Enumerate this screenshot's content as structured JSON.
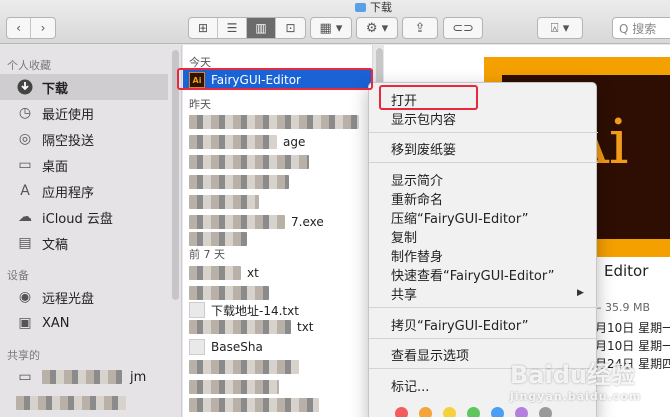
{
  "window": {
    "title": "下载"
  },
  "toolbar": {
    "back_icon": "chevron-left",
    "forward_icon": "chevron-right",
    "view_icons": [
      "⊞",
      "☰",
      "▥",
      "⊡"
    ],
    "group_icon": "▦ ▾",
    "action_icon": "⚙ ▾",
    "share_icon": "⇪",
    "tag_icon": "⊂⊃",
    "dropbox_icon": "⍓ ▾",
    "search_placeholder": "Q 搜索"
  },
  "sidebar": {
    "favorites_header": "个人收藏",
    "favorites": [
      {
        "label": "下载",
        "icon": "download-icon"
      },
      {
        "label": "最近使用",
        "icon": "clock-icon"
      },
      {
        "label": "隔空投送",
        "icon": "airdrop-icon"
      },
      {
        "label": "桌面",
        "icon": "desktop-icon"
      },
      {
        "label": "应用程序",
        "icon": "applications-icon"
      },
      {
        "label": "iCloud 云盘",
        "icon": "cloud-icon"
      },
      {
        "label": "文稿",
        "icon": "document-icon"
      }
    ],
    "devices_header": "设备",
    "devices": [
      {
        "label": "远程光盘",
        "icon": "disc-icon"
      },
      {
        "label": "XAN",
        "icon": "drive-icon"
      }
    ],
    "shared_header": "共享的",
    "shared_tail": "jm"
  },
  "files": {
    "today_header": "今天",
    "selected_file": "FairyGUI-Editor",
    "yesterday_header": "昨天",
    "yesterday_snippets": [
      "age",
      "7.exe"
    ],
    "week_header": "前 7 天",
    "week_snippets": [
      "xt",
      "下载地址-14.txt",
      "txt",
      "BaseSha"
    ]
  },
  "context_menu": {
    "open": "打开",
    "show_package": "显示包内容",
    "move_trash": "移到废纸篓",
    "get_info": "显示简介",
    "rename": "重新命名",
    "compress": "压缩“FairyGUI-Editor”",
    "duplicate": "复制",
    "make_alias": "制作替身",
    "quick_look": "快速查看“FairyGUI-Editor”",
    "share": "共享",
    "copy": "拷贝“FairyGUI-Editor”",
    "view_options": "查看显示选项",
    "tags": "标记...",
    "tag_colors": [
      "#f25c5c",
      "#f5a33b",
      "#f6d13c",
      "#5fc65f",
      "#4a9ff5",
      "#b57fe0",
      "#9a9a9a"
    ]
  },
  "preview": {
    "app_glyph": "Ai",
    "name": "Editor",
    "size": "– 35.9 MB",
    "meta": [
      "月10日 星期一",
      "月10日 星期一",
      "月24日 星期四"
    ]
  },
  "watermark": {
    "text": "Baidu经验",
    "sub": "jingyan.baidu.com"
  }
}
